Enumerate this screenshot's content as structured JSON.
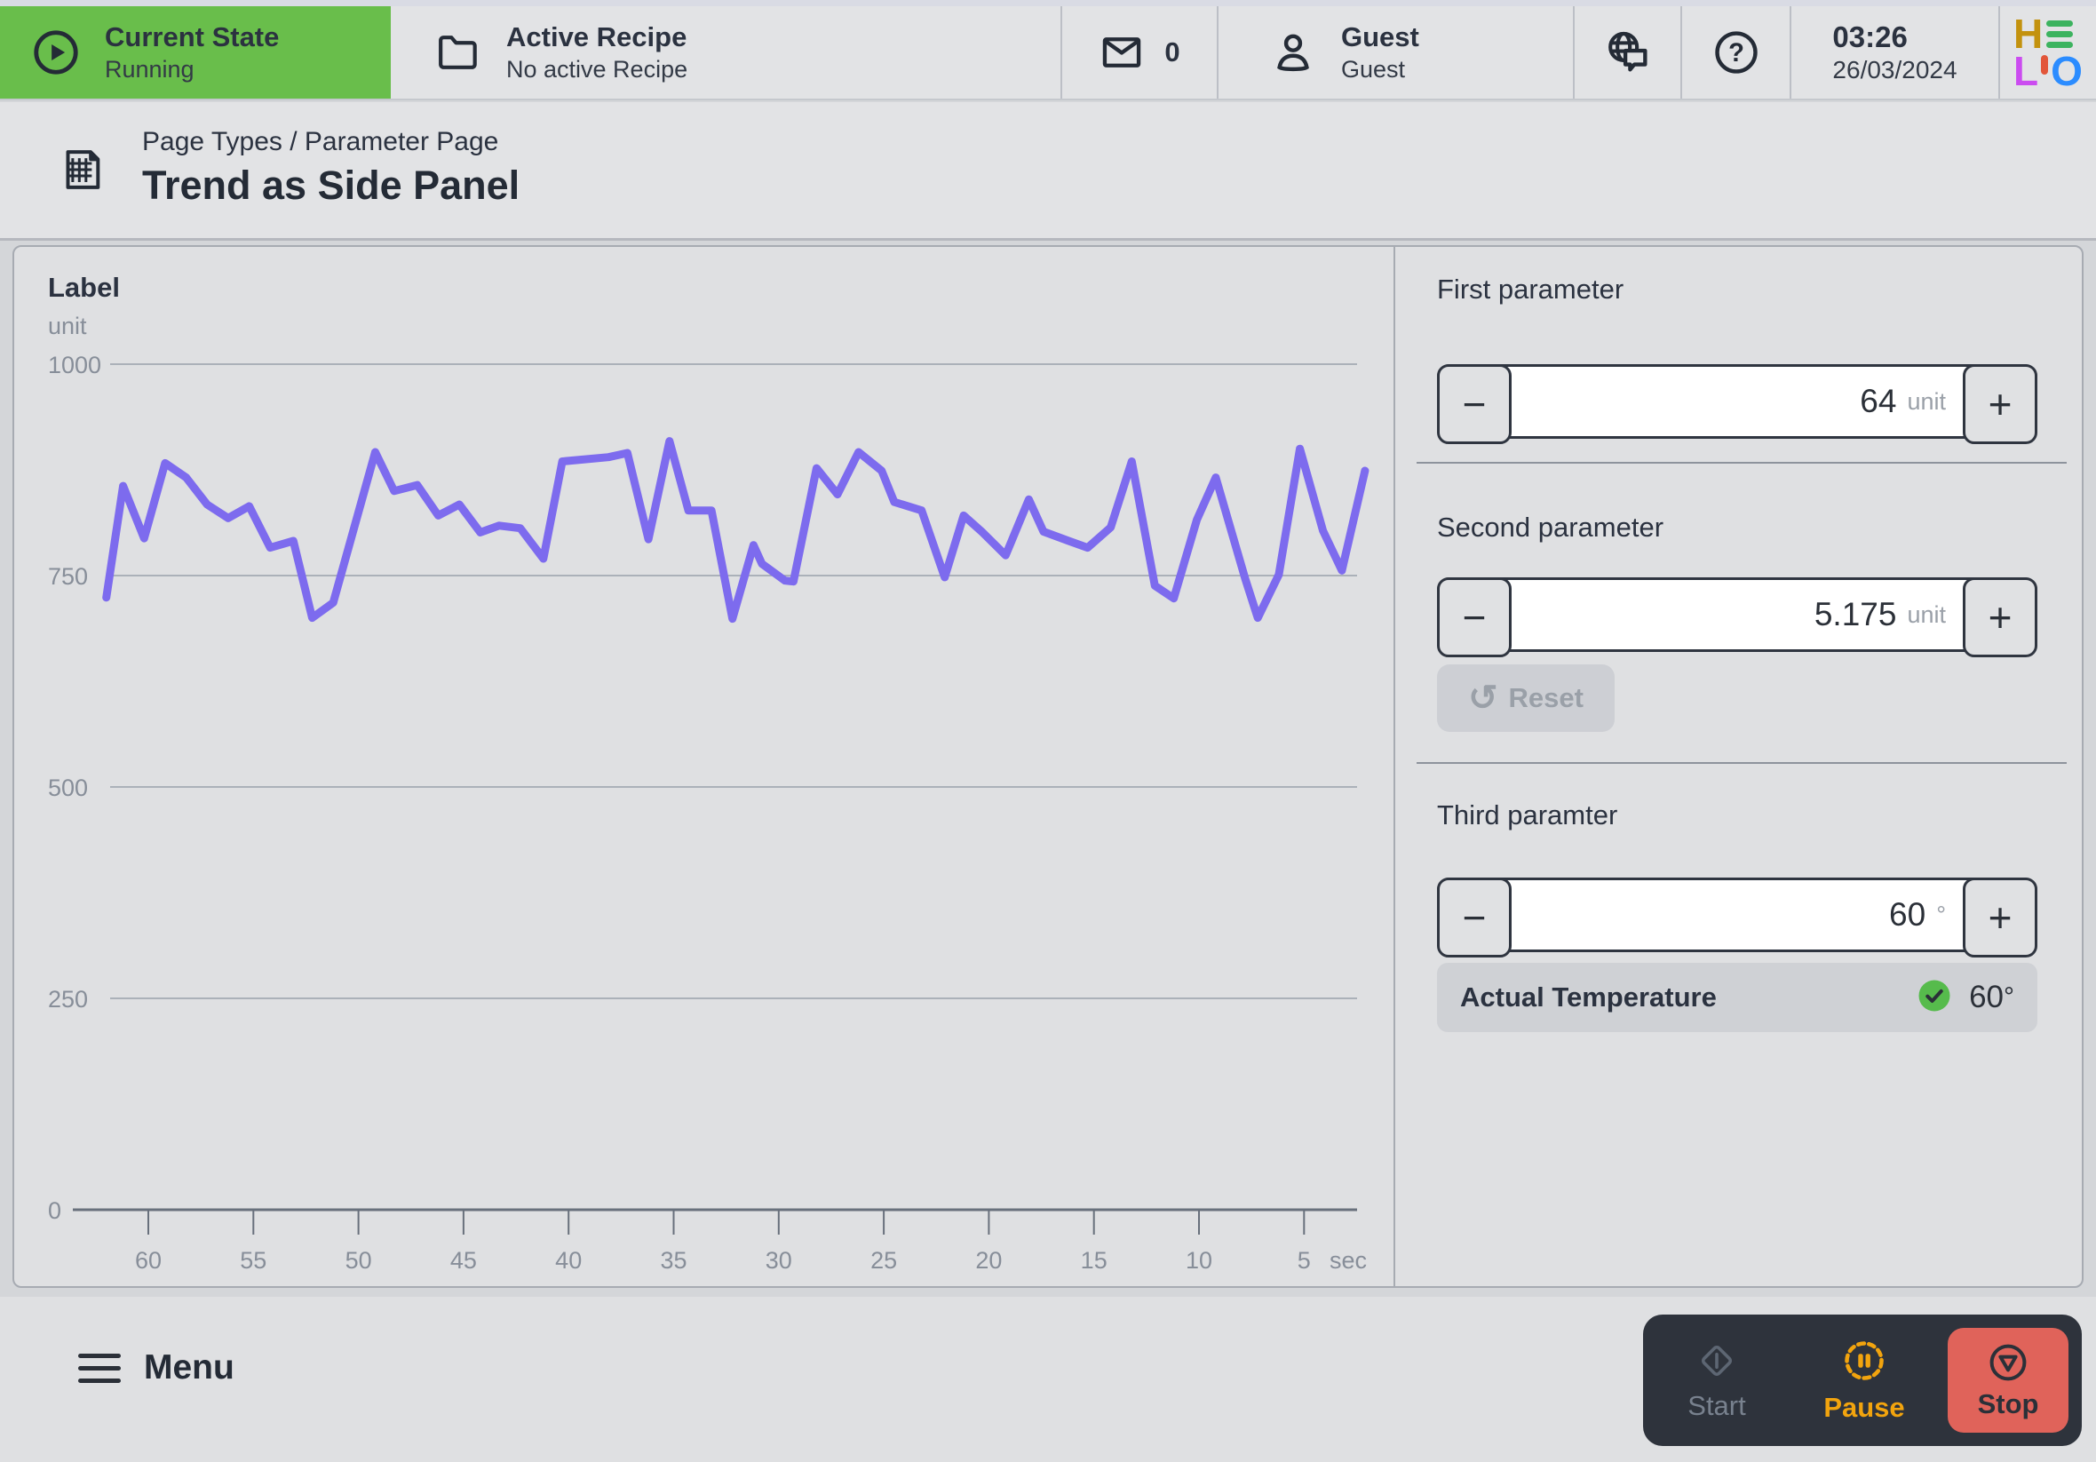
{
  "header": {
    "current_state": {
      "title": "Current State",
      "subtitle": "Running"
    },
    "active_recipe": {
      "title": "Active Recipe",
      "subtitle": "No active Recipe"
    },
    "messages_count": "0",
    "user": {
      "title": "Guest",
      "subtitle": "Guest"
    },
    "time": "03:26",
    "date": "26/03/2024",
    "logo": {
      "top_left": "H",
      "bottom_left": "L",
      "bottom_right": "O"
    }
  },
  "breadcrumb": {
    "path": "Page Types / Parameter Page",
    "title": "Trend as Side Panel"
  },
  "chart_data": {
    "type": "line",
    "title": "Label",
    "ylabel": "unit",
    "xlabel": "sec",
    "ylim": [
      0,
      1000
    ],
    "y_ticks": [
      1000,
      750,
      500,
      250,
      0
    ],
    "x_ticks": [
      60,
      55,
      50,
      45,
      40,
      35,
      30,
      25,
      20,
      15,
      10,
      5
    ],
    "grid": true,
    "legend": false,
    "line_color": "#7d6bee",
    "series": [
      {
        "name": "Label",
        "unit": "unit",
        "points": [
          [
            62.0,
            724
          ],
          [
            61.2,
            856
          ],
          [
            60.2,
            794
          ],
          [
            59.2,
            883
          ],
          [
            58.2,
            866
          ],
          [
            57.2,
            834
          ],
          [
            56.2,
            818
          ],
          [
            55.2,
            832
          ],
          [
            54.2,
            783
          ],
          [
            53.1,
            791
          ],
          [
            52.2,
            700
          ],
          [
            51.2,
            718
          ],
          [
            49.2,
            896
          ],
          [
            48.3,
            850
          ],
          [
            47.2,
            857
          ],
          [
            46.2,
            821
          ],
          [
            45.2,
            834
          ],
          [
            44.2,
            801
          ],
          [
            43.3,
            809
          ],
          [
            42.3,
            806
          ],
          [
            41.2,
            770
          ],
          [
            40.3,
            885
          ],
          [
            38.1,
            890
          ],
          [
            37.2,
            895
          ],
          [
            36.2,
            793
          ],
          [
            35.2,
            909
          ],
          [
            34.3,
            827
          ],
          [
            33.2,
            827
          ],
          [
            32.2,
            699
          ],
          [
            31.2,
            786
          ],
          [
            30.8,
            764
          ],
          [
            29.7,
            744
          ],
          [
            29.3,
            743
          ],
          [
            28.2,
            877
          ],
          [
            27.2,
            846
          ],
          [
            26.2,
            896
          ],
          [
            25.1,
            874
          ],
          [
            24.5,
            837
          ],
          [
            23.2,
            827
          ],
          [
            22.1,
            748
          ],
          [
            21.2,
            821
          ],
          [
            20.3,
            801
          ],
          [
            19.2,
            774
          ],
          [
            18.1,
            840
          ],
          [
            17.4,
            802
          ],
          [
            16.2,
            791
          ],
          [
            15.3,
            783
          ],
          [
            14.2,
            807
          ],
          [
            13.2,
            885
          ],
          [
            12.1,
            738
          ],
          [
            11.2,
            723
          ],
          [
            10.1,
            816
          ],
          [
            9.2,
            866
          ],
          [
            7.8,
            746
          ],
          [
            7.2,
            700
          ],
          [
            6.2,
            751
          ],
          [
            5.2,
            900
          ],
          [
            4.1,
            803
          ],
          [
            3.2,
            756
          ],
          [
            2.1,
            874
          ]
        ]
      }
    ]
  },
  "side_panel": {
    "sections": [
      {
        "label": "First parameter",
        "value": "64",
        "unit": "unit"
      },
      {
        "label": "Second parameter",
        "value": "5.175",
        "unit": "unit"
      },
      {
        "label": "Third paramter",
        "value": "60",
        "unit": "°"
      }
    ],
    "reset_label": "Reset",
    "status": {
      "label": "Actual Temperature",
      "value": "60",
      "unit": "°"
    }
  },
  "footer": {
    "menu_label": "Menu",
    "start_label": "Start",
    "pause_label": "Pause",
    "stop_label": "Stop"
  },
  "colors": {
    "accent_green": "#69be4b",
    "line_purple": "#7d6bee",
    "pause_orange": "#f2a40e",
    "stop_red": "#e0635a",
    "check_green": "#56bb4c",
    "dark_text": "#2b3240",
    "logo_h": "#c3920e",
    "logo_e": "#3cb35f",
    "logo_l": "#cb4cf0",
    "logo_accent": "#e2563a",
    "logo_o": "#2b8cff"
  }
}
